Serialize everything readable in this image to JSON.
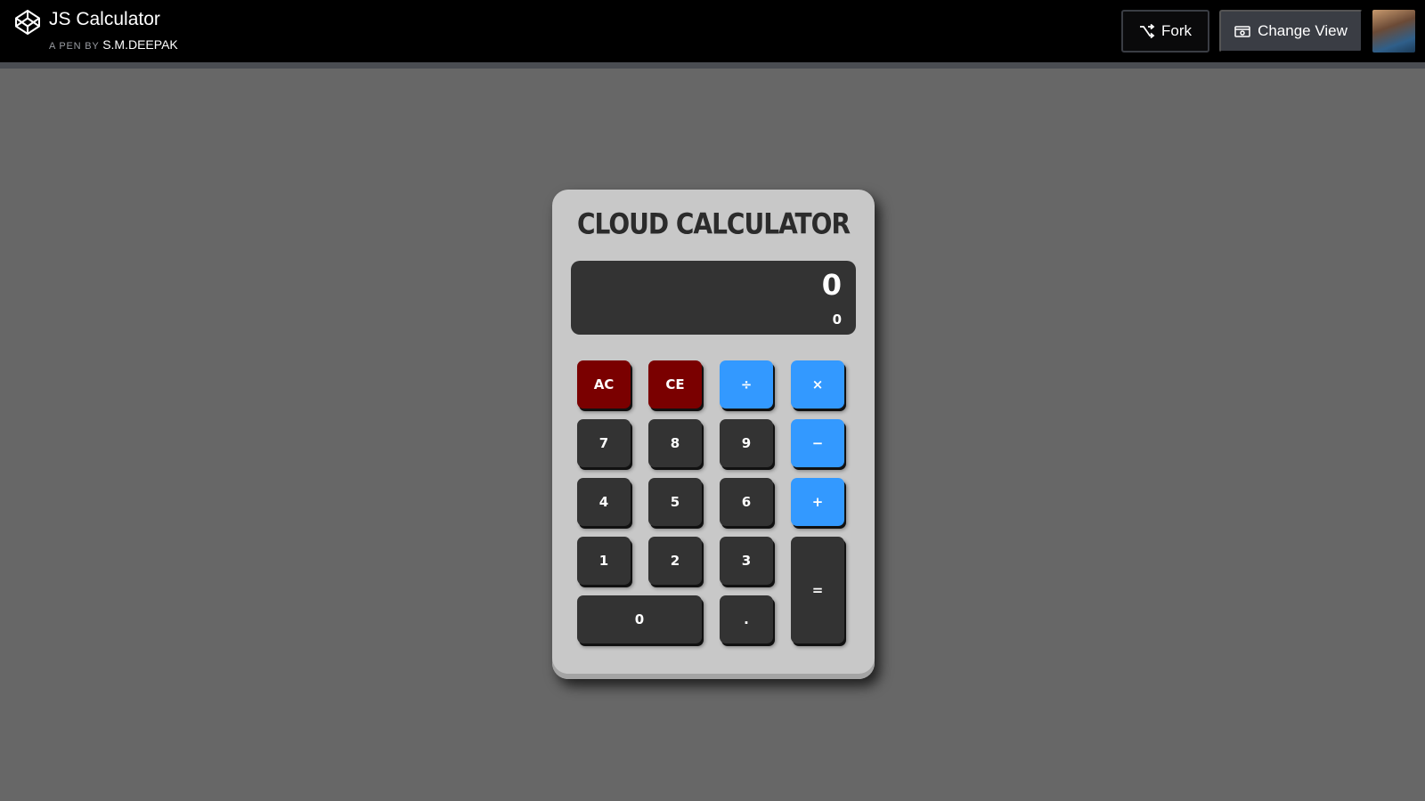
{
  "header": {
    "title": "JS Calculator",
    "by_prefix": "A PEN BY",
    "author": "S.M.DEEPAK",
    "fork_label": "Fork",
    "change_view_label": "Change View",
    "logo_icon": "codepen-logo-icon",
    "fork_icon": "fork-icon",
    "view_icon": "change-view-icon"
  },
  "calculator": {
    "title": "CLOUD CALCULATOR",
    "display_main": "0",
    "display_sub": "0",
    "keys": {
      "ac": "AC",
      "ce": "CE",
      "divide": "÷",
      "multiply": "×",
      "seven": "7",
      "eight": "8",
      "nine": "9",
      "minus": "−",
      "four": "4",
      "five": "5",
      "six": "6",
      "plus": "+",
      "one": "1",
      "two": "2",
      "three": "3",
      "equals": "=",
      "zero": "0",
      "decimal": "."
    }
  },
  "colors": {
    "page_bg": "#676767",
    "calculator_body": "#c8c8c8",
    "display_bg": "#333333",
    "number_key": "#333333",
    "clear_key": "#7a0000",
    "operator_key": "#3399ff"
  }
}
